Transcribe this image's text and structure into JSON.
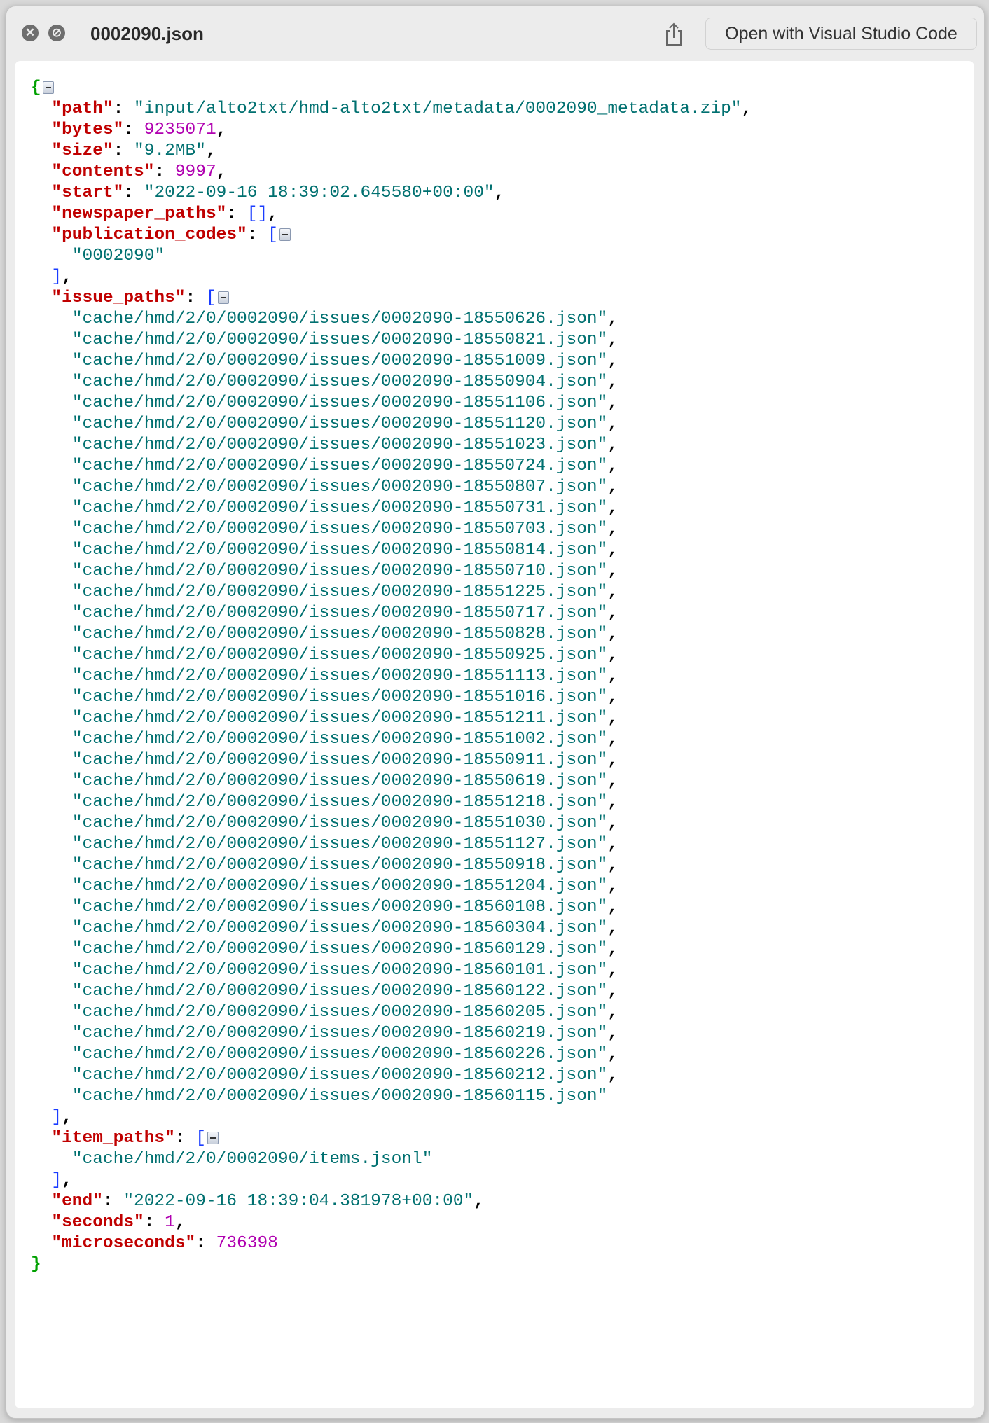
{
  "window": {
    "title": "0002090.json",
    "open_button_label": "Open with Visual Studio Code",
    "icons": {
      "close": "close-circle-icon",
      "disable": "no-entry-icon",
      "share": "share-icon",
      "toggle": "collapse-toggle-icon"
    }
  },
  "colors": {
    "key": "#c00000",
    "string": "#007070",
    "number": "#b000b0",
    "bracket": "#1a3cff",
    "brace": "#00a000"
  },
  "json": {
    "path": "input/alto2txt/hmd-alto2txt/metadata/0002090_metadata.zip",
    "bytes": "9235071",
    "size": "9.2MB",
    "contents": "9997",
    "start": "2022-09-16 18:39:02.645580+00:00",
    "publication_codes": [
      "0002090"
    ],
    "issue_paths": [
      "cache/hmd/2/0/0002090/issues/0002090-18550626.json",
      "cache/hmd/2/0/0002090/issues/0002090-18550821.json",
      "cache/hmd/2/0/0002090/issues/0002090-18551009.json",
      "cache/hmd/2/0/0002090/issues/0002090-18550904.json",
      "cache/hmd/2/0/0002090/issues/0002090-18551106.json",
      "cache/hmd/2/0/0002090/issues/0002090-18551120.json",
      "cache/hmd/2/0/0002090/issues/0002090-18551023.json",
      "cache/hmd/2/0/0002090/issues/0002090-18550724.json",
      "cache/hmd/2/0/0002090/issues/0002090-18550807.json",
      "cache/hmd/2/0/0002090/issues/0002090-18550731.json",
      "cache/hmd/2/0/0002090/issues/0002090-18550703.json",
      "cache/hmd/2/0/0002090/issues/0002090-18550814.json",
      "cache/hmd/2/0/0002090/issues/0002090-18550710.json",
      "cache/hmd/2/0/0002090/issues/0002090-18551225.json",
      "cache/hmd/2/0/0002090/issues/0002090-18550717.json",
      "cache/hmd/2/0/0002090/issues/0002090-18550828.json",
      "cache/hmd/2/0/0002090/issues/0002090-18550925.json",
      "cache/hmd/2/0/0002090/issues/0002090-18551113.json",
      "cache/hmd/2/0/0002090/issues/0002090-18551016.json",
      "cache/hmd/2/0/0002090/issues/0002090-18551211.json",
      "cache/hmd/2/0/0002090/issues/0002090-18551002.json",
      "cache/hmd/2/0/0002090/issues/0002090-18550911.json",
      "cache/hmd/2/0/0002090/issues/0002090-18550619.json",
      "cache/hmd/2/0/0002090/issues/0002090-18551218.json",
      "cache/hmd/2/0/0002090/issues/0002090-18551030.json",
      "cache/hmd/2/0/0002090/issues/0002090-18551127.json",
      "cache/hmd/2/0/0002090/issues/0002090-18550918.json",
      "cache/hmd/2/0/0002090/issues/0002090-18551204.json",
      "cache/hmd/2/0/0002090/issues/0002090-18560108.json",
      "cache/hmd/2/0/0002090/issues/0002090-18560304.json",
      "cache/hmd/2/0/0002090/issues/0002090-18560129.json",
      "cache/hmd/2/0/0002090/issues/0002090-18560101.json",
      "cache/hmd/2/0/0002090/issues/0002090-18560122.json",
      "cache/hmd/2/0/0002090/issues/0002090-18560205.json",
      "cache/hmd/2/0/0002090/issues/0002090-18560219.json",
      "cache/hmd/2/0/0002090/issues/0002090-18560226.json",
      "cache/hmd/2/0/0002090/issues/0002090-18560212.json",
      "cache/hmd/2/0/0002090/issues/0002090-18560115.json"
    ],
    "item_paths": [
      "cache/hmd/2/0/0002090/items.jsonl"
    ],
    "end": "2022-09-16 18:39:04.381978+00:00",
    "seconds": "1",
    "microseconds": "736398"
  }
}
